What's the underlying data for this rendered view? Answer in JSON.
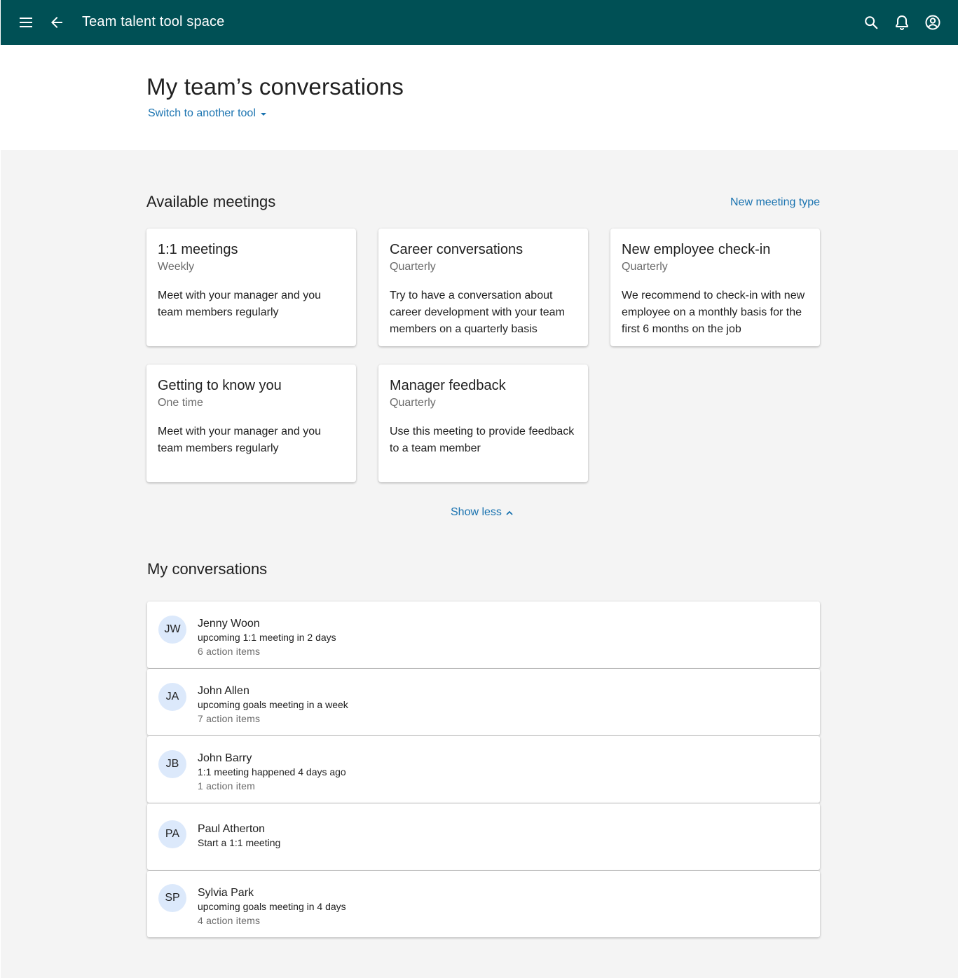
{
  "app_bar": {
    "title": "Team talent tool space",
    "icons": [
      "menu-icon",
      "back-arrow-icon",
      "search-icon",
      "bell-icon",
      "account-icon"
    ],
    "background": "#005055"
  },
  "header": {
    "page_title": "My team’s conversations",
    "switch_tool_label": "Switch to another tool"
  },
  "available_meetings": {
    "title": "Available meetings",
    "new_meeting_label": "New meeting type",
    "cards": [
      {
        "title": "1:1 meetings",
        "frequency": "Weekly",
        "description": "Meet with your manager and you team members regularly"
      },
      {
        "title": "Career conversations",
        "frequency": "Quarterly",
        "description": "Try to have a conversation about career development with your team members on a quarterly basis"
      },
      {
        "title": "New employee check-in",
        "frequency": "Quarterly",
        "description": "We recommend to check-in with new employee on a monthly basis for the first 6 months on the job"
      },
      {
        "title": "Getting to know you",
        "frequency": "One time",
        "description": "Meet with your manager and you team members regularly"
      },
      {
        "title": "Manager feedback",
        "frequency": "Quarterly",
        "description": "Use this meeting to provide feedback to a team member"
      }
    ],
    "show_less_label": "Show less"
  },
  "my_conversations": {
    "title": "My conversations",
    "rows": [
      {
        "initials": "JW",
        "name": "Jenny Woon",
        "status": "upcoming 1:1 meeting in 2 days",
        "items": "6 action items"
      },
      {
        "initials": "JA",
        "name": "John Allen",
        "status": "upcoming goals meeting in a week",
        "items": "7 action items"
      },
      {
        "initials": "JB",
        "name": "John Barry",
        "status": "1:1 meeting happened 4 days ago",
        "items": "1 action item"
      },
      {
        "initials": "PA",
        "name": "Paul Atherton",
        "status": "Start a 1:1 meeting",
        "items": ""
      },
      {
        "initials": "SP",
        "name": "Sylvia Park",
        "status": "upcoming goals meeting in 4 days",
        "items": "4 action items"
      }
    ]
  },
  "colors": {
    "accent_link": "#1a73b0",
    "avatar_bg": "#dce9fb",
    "content_bg": "#f4f4f4"
  }
}
